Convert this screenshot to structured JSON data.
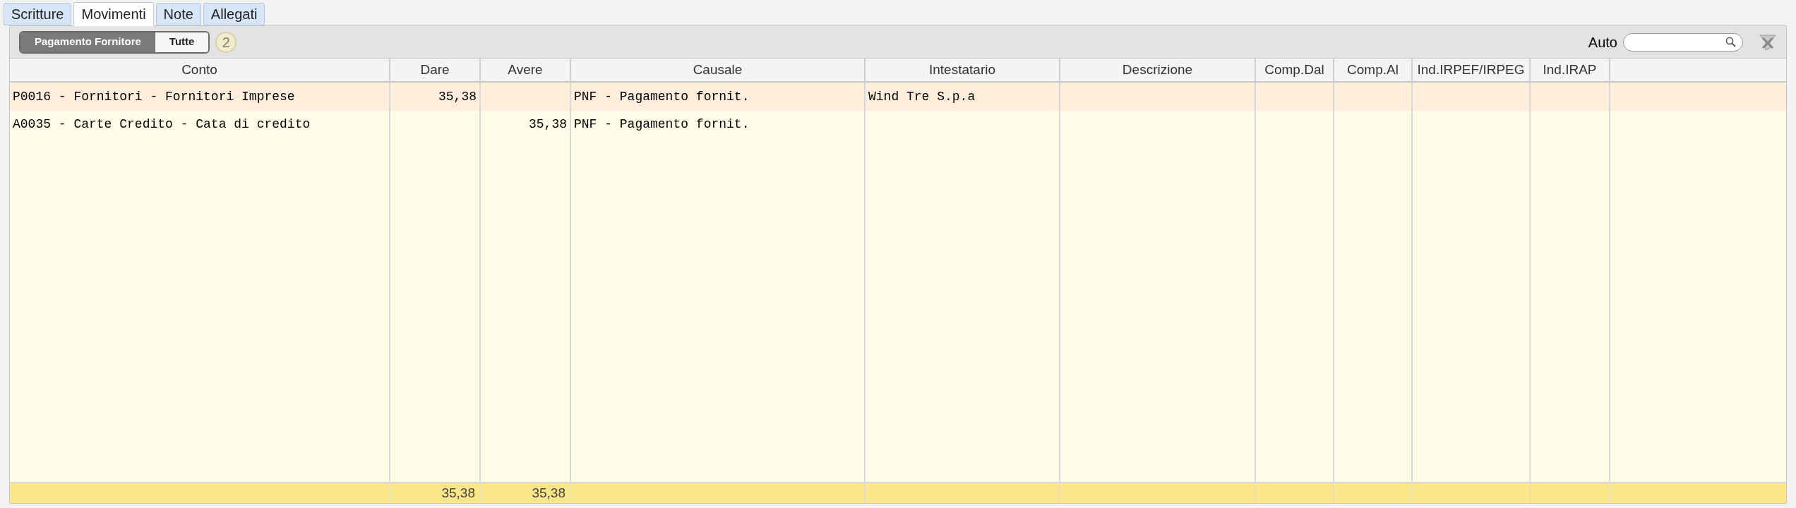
{
  "tabs": [
    {
      "label": "Scritture",
      "selected": false
    },
    {
      "label": "Movimenti",
      "selected": true
    },
    {
      "label": "Note",
      "selected": false
    },
    {
      "label": "Allegati",
      "selected": false
    }
  ],
  "filters": [
    {
      "label": "Pagamento Fornitore",
      "selected": true
    },
    {
      "label": "Tutte",
      "selected": false
    }
  ],
  "count_badge": "2",
  "search": {
    "label": "Auto"
  },
  "table": {
    "columns": [
      "Conto",
      "Dare",
      "Avere",
      "Causale",
      "Intestatario",
      "Descrizione",
      "Comp.Dal",
      "Comp.Al",
      "Ind.IRPEF/IRPEG",
      "Ind.IRAP"
    ],
    "rows": [
      {
        "selected": true,
        "conto": "P0016 - Fornitori - Fornitori Imprese",
        "dare": "35,38",
        "causale": "PNF - Pagamento fornit.",
        "intestatario": "Wind Tre S.p.a"
      },
      {
        "selected": false,
        "conto": "A0035 - Carte Credito - Cata di credito",
        "avere": "35,38",
        "causale": "PNF - Pagamento fornit."
      }
    ],
    "totals": {
      "dare": "35,38",
      "avere": "35,38"
    }
  }
}
